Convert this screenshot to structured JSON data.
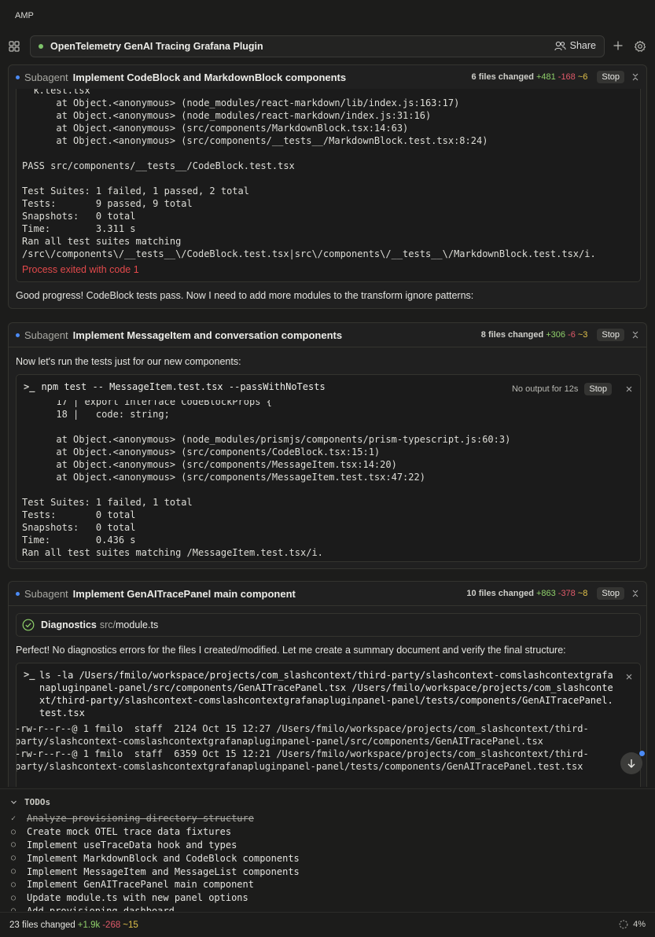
{
  "app": {
    "title": "AMP"
  },
  "thread": {
    "title": "OpenTelemetry GenAI Tracing Grafana Plugin",
    "share_label": "Share"
  },
  "subagents": [
    {
      "label": "Subagent",
      "title": "Implement CodeBlock and MarkdownBlock components",
      "files_changed": "6 files changed",
      "added": "+481",
      "removed": "-168",
      "modified": "~6",
      "stop_label": "Stop",
      "terminal_lines": [
        "  k.test.tsx",
        "      at Object.<anonymous> (node_modules/react-markdown/lib/index.js:163:17)",
        "      at Object.<anonymous> (node_modules/react-markdown/index.js:31:16)",
        "      at Object.<anonymous> (src/components/MarkdownBlock.tsx:14:63)",
        "      at Object.<anonymous> (src/components/__tests__/MarkdownBlock.test.tsx:8:24)",
        "",
        "PASS src/components/__tests__/CodeBlock.test.tsx",
        "",
        "Test Suites: 1 failed, 1 passed, 2 total",
        "Tests:       9 passed, 9 total",
        "Snapshots:   0 total",
        "Time:        3.311 s",
        "Ran all test suites matching",
        "/src\\/components\\/__tests__\\/CodeBlock.test.tsx|src\\/components\\/__tests__\\/MarkdownBlock.test.tsx/i."
      ],
      "exit_message": "Process exited with code 1",
      "message": "Good progress! CodeBlock tests pass. Now I need to add more modules to the transform ignore patterns:"
    },
    {
      "label": "Subagent",
      "title": "Implement MessageItem and conversation components",
      "files_changed": "8 files changed",
      "added": "+306",
      "removed": "-6",
      "modified": "~3",
      "stop_label": "Stop",
      "intro": "Now let's run the tests just for our new components:",
      "command": "npm test -- MessageItem.test.tsx --passWithNoTests",
      "no_output": "No output for 12s",
      "terminal_stop_label": "Stop",
      "terminal_lines": [
        "      17 | export interface CodeBlockProps {",
        "      18 |   code: string;",
        "",
        "      at Object.<anonymous> (node_modules/prismjs/components/prism-typescript.js:60:3)",
        "      at Object.<anonymous> (src/components/CodeBlock.tsx:15:1)",
        "      at Object.<anonymous> (src/components/MessageItem.tsx:14:20)",
        "      at Object.<anonymous> (src/components/MessageItem.test.tsx:47:22)",
        "",
        "Test Suites: 1 failed, 1 total",
        "Tests:       0 total",
        "Snapshots:   0 total",
        "Time:        0.436 s",
        "Ran all test suites matching /MessageItem.test.tsx/i."
      ]
    },
    {
      "label": "Subagent",
      "title": "Implement GenAITracePanel main component",
      "files_changed": "10 files changed",
      "added": "+863",
      "removed": "-378",
      "modified": "~8",
      "stop_label": "Stop",
      "diagnostics_label": "Diagnostics",
      "diagnostics_dir": "src/",
      "diagnostics_file": "module.ts",
      "message": "Perfect! No diagnostics errors for the files I created/modified. Let me create a summary document and verify the final structure:",
      "command_lines": [
        "ls -la /Users/fmilo/workspace/projects/com_slashcontext/third-party/slashcontext-comslashcontextgrafa",
        "napluginpanel-panel/src/components/GenAITracePanel.tsx /Users/fmilo/workspace/projects/com_slashconte",
        "xt/third-party/slashcontext-comslashcontextgrafanapluginpanel-panel/tests/components/GenAITracePanel.",
        "test.tsx"
      ],
      "output_lines": [
        "-rw-r--r--@ 1 fmilo  staff  2124 Oct 15 12:27 /Users/fmilo/workspace/projects/com_slashcontext/third-",
        "party/slashcontext-comslashcontextgrafanapluginpanel-panel/src/components/GenAITracePanel.tsx",
        "-rw-r--r--@ 1 fmilo  staff  6359 Oct 15 12:21 /Users/fmilo/workspace/projects/com_slashcontext/third-",
        "party/slashcontext-comslashcontextgrafanapluginpanel-panel/tests/components/GenAITracePanel.test.tsx"
      ]
    }
  ],
  "todos": {
    "header": "TODOs",
    "items": [
      {
        "text": "Analyze provisioning directory structure",
        "done": true
      },
      {
        "text": "Create mock OTEL trace data fixtures",
        "done": false
      },
      {
        "text": "Implement useTraceData hook and types",
        "done": false
      },
      {
        "text": "Implement MarkdownBlock and CodeBlock components",
        "done": false
      },
      {
        "text": "Implement MessageItem and MessageList components",
        "done": false
      },
      {
        "text": "Implement GenAITracePanel main component",
        "done": false
      },
      {
        "text": "Update module.ts with new panel options",
        "done": false
      },
      {
        "text": "Add provisioning dashboard",
        "done": false
      }
    ]
  },
  "status": {
    "files_changed": "23 files changed",
    "added": "+1.9k",
    "removed": "-268",
    "modified": "~15",
    "progress": "4%"
  },
  "colors": {
    "added": "#8fcf6a",
    "removed": "#e05a6a",
    "modified": "#e0c14a",
    "accent": "#4b8bf5",
    "error": "#e2494b"
  }
}
